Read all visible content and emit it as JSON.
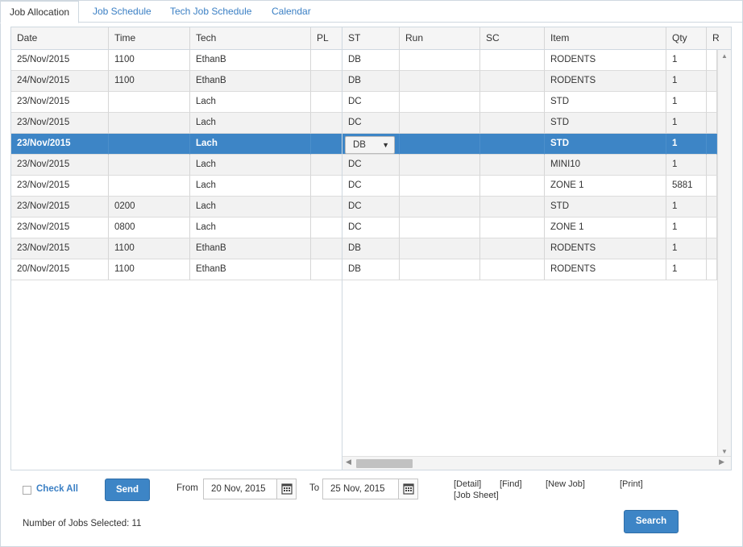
{
  "tabs": [
    {
      "label": "Job Allocation"
    },
    {
      "label": "Job Schedule"
    },
    {
      "label": "Tech Job Schedule"
    },
    {
      "label": "Calendar"
    }
  ],
  "columns": {
    "date": "Date",
    "time": "Time",
    "tech": "Tech",
    "pl": "PL",
    "st": "ST",
    "run": "Run",
    "sc": "SC",
    "item": "Item",
    "qty": "Qty",
    "r": "R"
  },
  "rows": [
    {
      "date": "25/Nov/2015",
      "time": "1100",
      "tech": "EthanB",
      "pl": "",
      "st": "DB",
      "run": "",
      "sc": "",
      "item": "RODENTS",
      "qty": "1"
    },
    {
      "date": "24/Nov/2015",
      "time": "1100",
      "tech": "EthanB",
      "pl": "",
      "st": "DB",
      "run": "",
      "sc": "",
      "item": "RODENTS",
      "qty": "1"
    },
    {
      "date": "23/Nov/2015",
      "time": "",
      "tech": "Lach",
      "pl": "",
      "st": "DC",
      "run": "",
      "sc": "",
      "item": "STD",
      "qty": "1"
    },
    {
      "date": "23/Nov/2015",
      "time": "",
      "tech": "Lach",
      "pl": "",
      "st": "DC",
      "run": "",
      "sc": "",
      "item": "STD",
      "qty": "1"
    },
    {
      "date": "23/Nov/2015",
      "time": "",
      "tech": "Lach",
      "pl": "",
      "st": "DB",
      "run": "",
      "sc": "",
      "item": "STD",
      "qty": "1"
    },
    {
      "date": "23/Nov/2015",
      "time": "",
      "tech": "Lach",
      "pl": "",
      "st": "DC",
      "run": "",
      "sc": "",
      "item": "MINI10",
      "qty": "1"
    },
    {
      "date": "23/Nov/2015",
      "time": "",
      "tech": "Lach",
      "pl": "",
      "st": "DC",
      "run": "",
      "sc": "",
      "item": "ZONE 1",
      "qty": "5881"
    },
    {
      "date": "23/Nov/2015",
      "time": "0200",
      "tech": "Lach",
      "pl": "",
      "st": "DC",
      "run": "",
      "sc": "",
      "item": "STD",
      "qty": "1"
    },
    {
      "date": "23/Nov/2015",
      "time": "0800",
      "tech": "Lach",
      "pl": "",
      "st": "DC",
      "run": "",
      "sc": "",
      "item": "ZONE 1",
      "qty": "1"
    },
    {
      "date": "23/Nov/2015",
      "time": "1100",
      "tech": "EthanB",
      "pl": "",
      "st": "DB",
      "run": "",
      "sc": "",
      "item": "RODENTS",
      "qty": "1"
    },
    {
      "date": "20/Nov/2015",
      "time": "1100",
      "tech": "EthanB",
      "pl": "",
      "st": "DB",
      "run": "",
      "sc": "",
      "item": "RODENTS",
      "qty": "1"
    }
  ],
  "selected_row_index": 4,
  "controls": {
    "check_all": "Check All",
    "send": "Send",
    "from_label": "From",
    "from_value": "20 Nov, 2015",
    "to_label": "To",
    "to_value": "25 Nov, 2015",
    "links": [
      "[Detail]",
      "[Find]",
      "[New Job]",
      "[Print]",
      "[Job Sheet]"
    ],
    "search": "Search",
    "jobs_selected": "Number of Jobs Selected: 11"
  },
  "icons": {
    "calendar": "calendar-icon",
    "dropdown": "chevron-down-icon"
  },
  "colors": {
    "accent": "#3d85c6",
    "link": "#3a7fc4",
    "border": "#cfd8e0"
  }
}
